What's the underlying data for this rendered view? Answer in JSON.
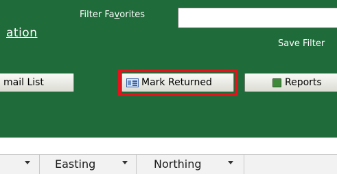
{
  "header": {
    "nav_link": "ation",
    "filter_label_pre": "Filter Fa",
    "filter_label_key": "v",
    "filter_label_post": "orites",
    "filter_value": "",
    "save_filter": "Save Filter"
  },
  "toolbar": {
    "email_list_label": "mail List",
    "mark_returned_label": "Mark Returned",
    "reports_label": "Reports",
    "mark_returned_highlight_color": "#e8101a"
  },
  "table": {
    "columns": [
      {
        "label": ""
      },
      {
        "label": "Easting"
      },
      {
        "label": "Northing"
      }
    ]
  },
  "colors": {
    "header_bg": "#1f6b3a",
    "text_on_header": "#ffffff"
  },
  "icons": {
    "mark_returned": "form-icon",
    "reports": "report-icon",
    "dropdown": "dropdown-arrow-icon"
  }
}
